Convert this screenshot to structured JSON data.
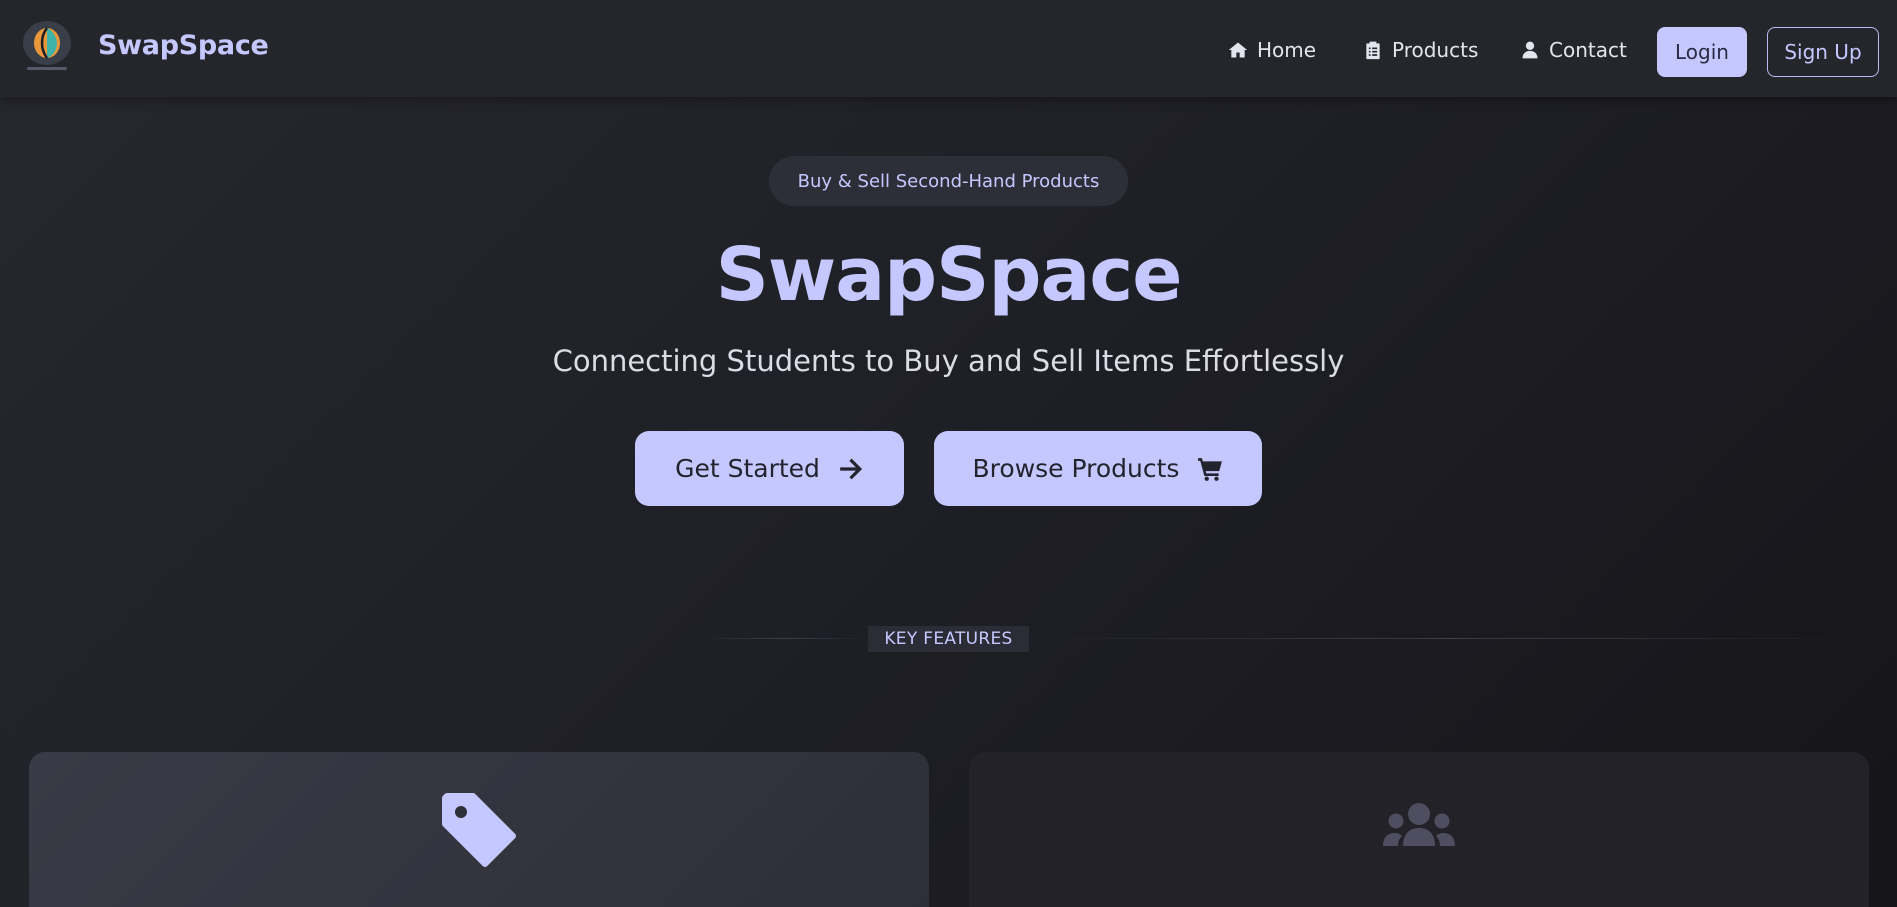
{
  "nav": {
    "brand": "SwapSpace",
    "logo_icon": "swapspace-logo",
    "links": [
      {
        "label": "Home",
        "icon": "home-icon"
      },
      {
        "label": "Products",
        "icon": "clipboard-icon"
      },
      {
        "label": "Contact",
        "icon": "user-icon"
      }
    ],
    "login_label": "Login",
    "signup_label": "Sign Up"
  },
  "hero": {
    "badge": "Buy & Sell Second-Hand Products",
    "title": "SwapSpace",
    "subtitle": "Connecting Students to Buy and Sell Items Effortlessly",
    "buttons": [
      {
        "label": "Get Started",
        "icon": "arrow-right-icon"
      },
      {
        "label": "Browse Products",
        "icon": "shopping-cart-icon"
      }
    ]
  },
  "features": {
    "section_label": "KEY FEATURES",
    "cards": [
      {
        "icon": "tag-icon"
      },
      {
        "icon": "users-icon"
      }
    ]
  },
  "colors": {
    "accent": "#c5c8ff",
    "background": "#1e1e25",
    "navbar": "#25252c",
    "card": "#34343f"
  }
}
